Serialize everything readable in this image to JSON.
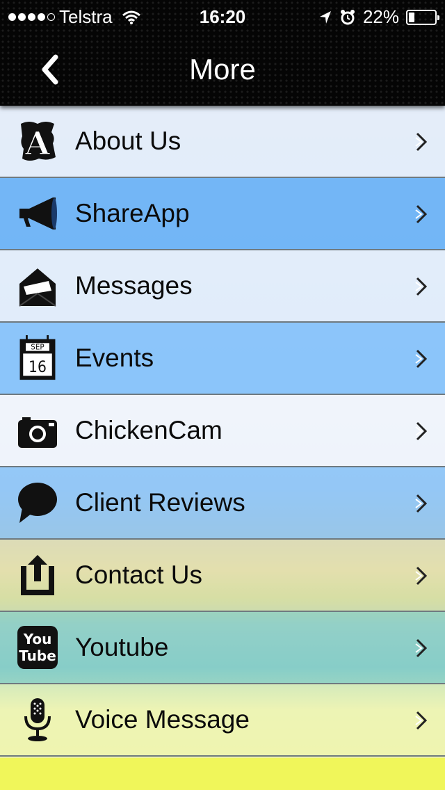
{
  "status_bar": {
    "carrier": "Telstra",
    "time": "16:20",
    "battery": "22%",
    "battery_level": 0.22,
    "signal_bars": 4,
    "signal_max": 5
  },
  "nav": {
    "title": "More",
    "back_icon": "chevron-left-icon"
  },
  "menu": {
    "items": [
      {
        "label": "About Us",
        "icon": "letter-a-icon"
      },
      {
        "label": "ShareApp",
        "icon": "megaphone-icon"
      },
      {
        "label": "Messages",
        "icon": "envelope-icon"
      },
      {
        "label": "Events",
        "icon": "calendar-icon",
        "calendar_month": "SEP",
        "calendar_day": "16"
      },
      {
        "label": "ChickenCam",
        "icon": "camera-icon"
      },
      {
        "label": "Client Reviews",
        "icon": "speech-bubble-icon"
      },
      {
        "label": "Contact Us",
        "icon": "upload-tray-icon"
      },
      {
        "label": "Youtube",
        "icon": "youtube-icon",
        "icon_text_1": "You",
        "icon_text_2": "Tube"
      },
      {
        "label": "Voice Message",
        "icon": "microphone-icon"
      }
    ]
  }
}
